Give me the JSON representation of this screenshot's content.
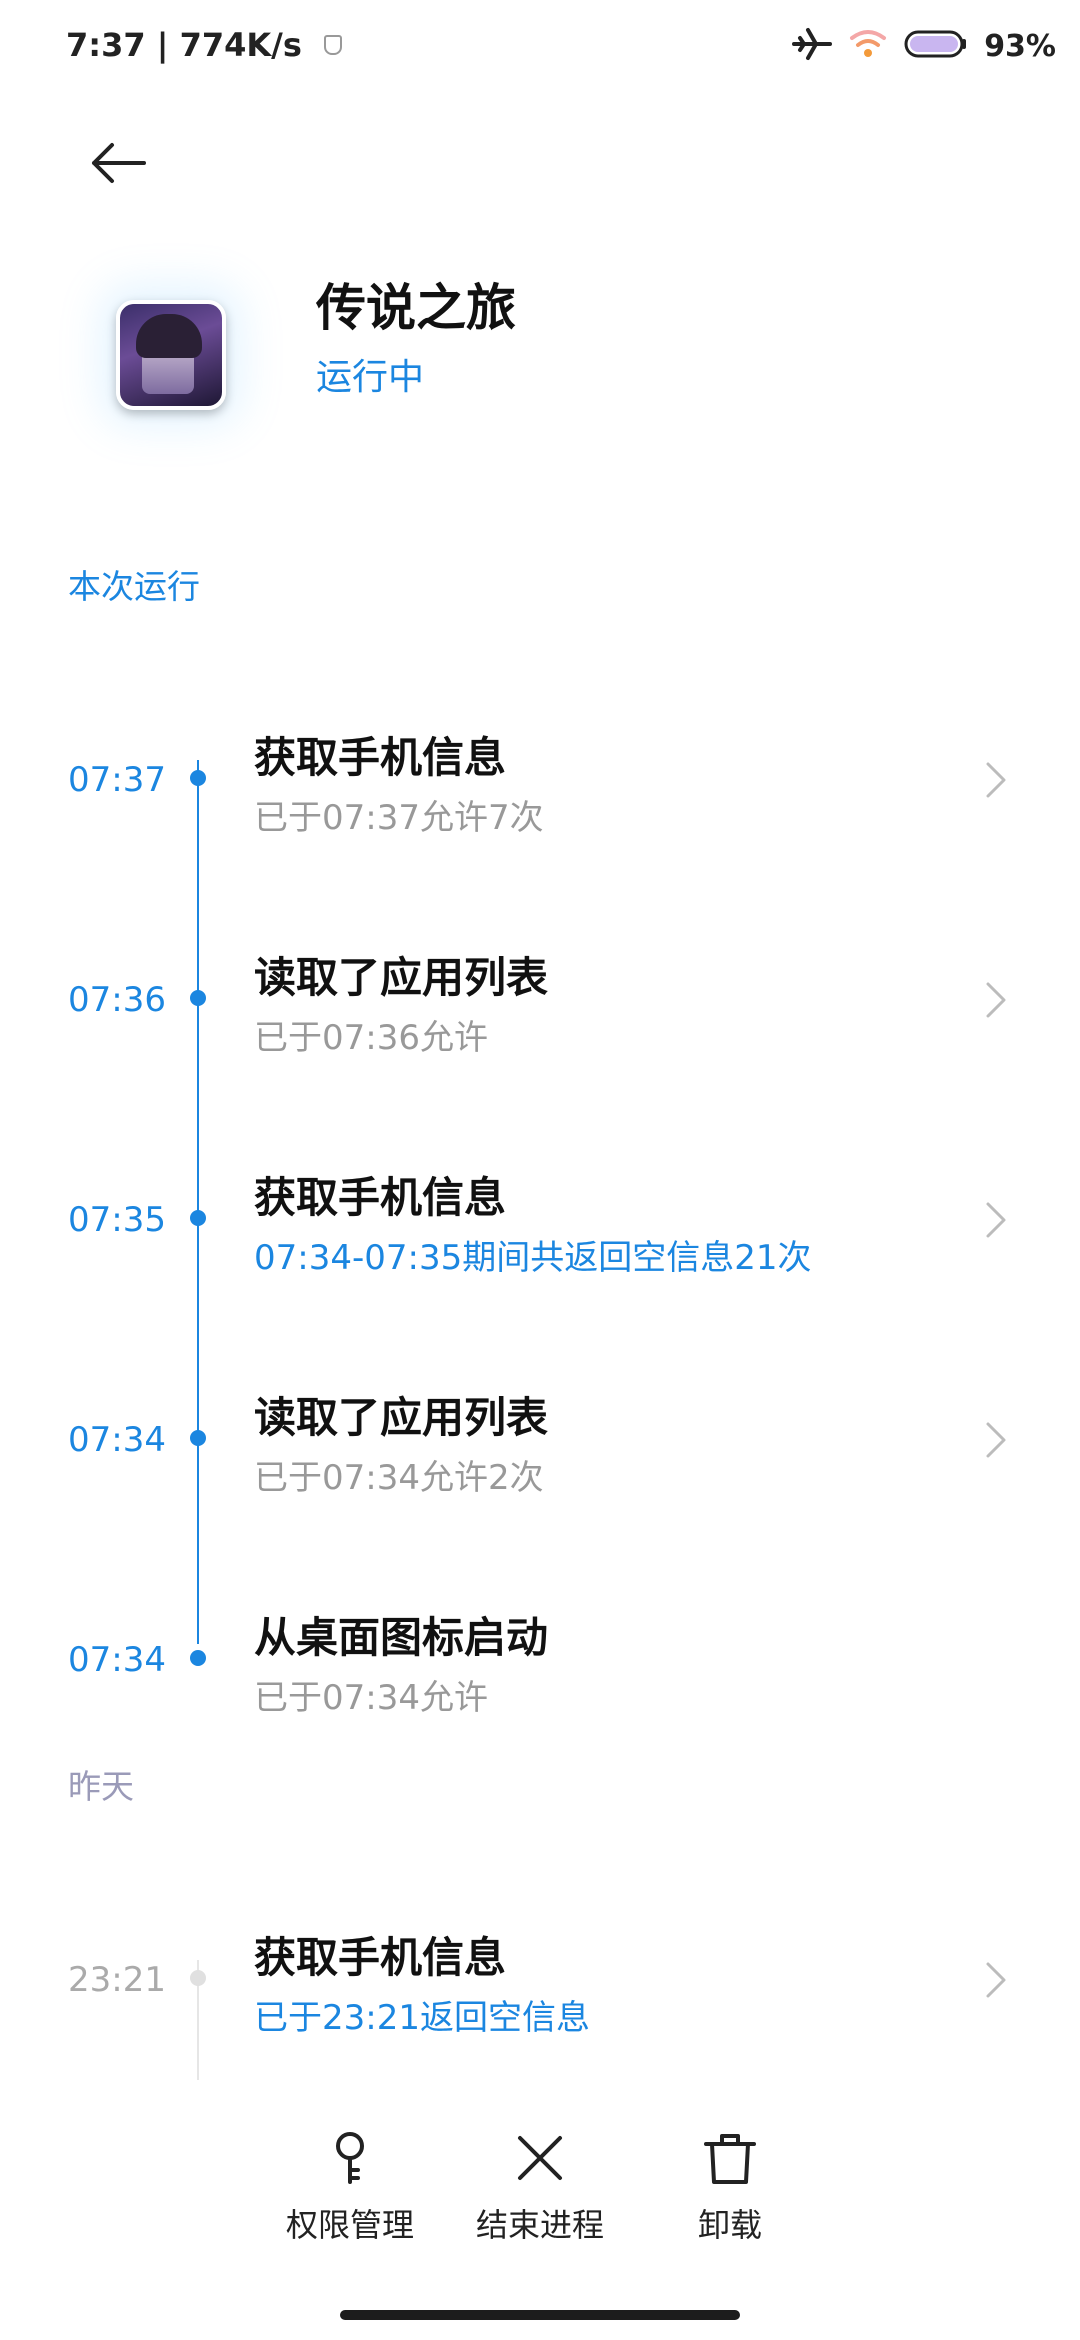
{
  "status_bar": {
    "time_speed": "7:37 | 774K/s",
    "battery_percent": "93%",
    "icons": [
      "shield-icon",
      "airplane-icon",
      "wifi-icon",
      "battery-icon"
    ]
  },
  "header": {
    "app_name": "传说之旅",
    "app_state": "运行中"
  },
  "sections": {
    "current": "本次运行",
    "yesterday": "昨天"
  },
  "timeline": [
    {
      "time": "07:37",
      "title": "获取手机信息",
      "sub": "已于07:37允许7次",
      "sub_highlight": false
    },
    {
      "time": "07:36",
      "title": "读取了应用列表",
      "sub": "已于07:36允许",
      "sub_highlight": false
    },
    {
      "time": "07:35",
      "title": "获取手机信息",
      "sub": "07:34-07:35期间共返回空信息21次",
      "sub_highlight": true
    },
    {
      "time": "07:34",
      "title": "读取了应用列表",
      "sub": "已于07:34允许2次",
      "sub_highlight": false
    },
    {
      "time": "07:34",
      "title": "从桌面图标启动",
      "sub": "已于07:34允许",
      "sub_highlight": false
    }
  ],
  "yesterday_timeline": [
    {
      "time": "23:21",
      "title": "获取手机信息",
      "sub": "已于23:21返回空信息",
      "sub_highlight": true
    }
  ],
  "bottom_actions": {
    "permissions": "权限管理",
    "end_process": "结束进程",
    "uninstall": "卸载"
  },
  "colors": {
    "accent": "#1b86e0",
    "muted": "#999999",
    "section_muted": "#9a9ab8"
  }
}
